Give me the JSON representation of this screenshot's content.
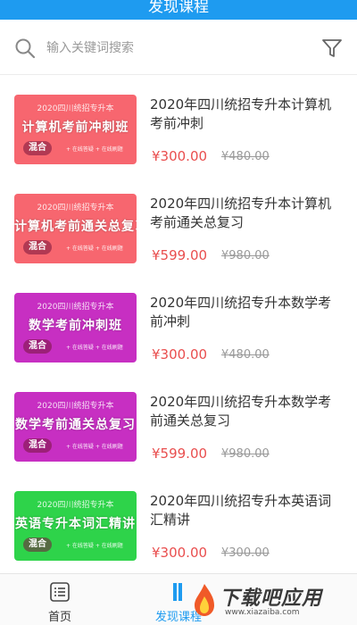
{
  "header": {
    "title": "发现课程"
  },
  "search": {
    "placeholder": "输入关键词搜索"
  },
  "colors": {
    "accent": "#1e9bf0",
    "price": "#e94e4e"
  },
  "courses": [
    {
      "title": "2020年四川统招专升本计算机考前冲刺",
      "price": "¥300.00",
      "original_price": "¥480.00",
      "thumb": {
        "year": "2020四川统招专升本",
        "title": "计算机考前冲刺班",
        "tag": "混合",
        "features": "+ 在线答疑 + 在线刷题",
        "color": "#f7666f"
      }
    },
    {
      "title": "2020年四川统招专升本计算机考前通关总复习",
      "price": "¥599.00",
      "original_price": "¥980.00",
      "thumb": {
        "year": "2020四川统招专升本",
        "title": "计算机考前通关总复习",
        "tag": "混合",
        "features": "+ 在线答疑 + 在线刷题",
        "color": "#f7666f"
      }
    },
    {
      "title": "2020年四川统招专升本数学考前冲刺",
      "price": "¥300.00",
      "original_price": "¥480.00",
      "thumb": {
        "year": "2020四川统招专升本",
        "title": "数学考前冲刺班",
        "tag": "混合",
        "features": "+ 在线答疑 + 在线刷题",
        "color": "#c72fc2"
      }
    },
    {
      "title": "2020年四川统招专升本数学考前通关总复习",
      "price": "¥599.00",
      "original_price": "¥980.00",
      "thumb": {
        "year": "2020四川统招专升本",
        "title": "数学考前通关总复习",
        "tag": "混合",
        "features": "+ 在线答疑 + 在线刷题",
        "color": "#c72fc2"
      }
    },
    {
      "title": "2020年四川统招专升本英语词汇精讲",
      "price": "¥300.00",
      "original_price": "¥300.00",
      "thumb": {
        "year": "2020四川统招专升本",
        "title": "英语专升本词汇精讲",
        "tag": "混合",
        "features": "+ 在线答疑 + 在线刷题",
        "color": "#2ed34a"
      }
    }
  ],
  "tabs": [
    {
      "label": "首页",
      "icon": "home-list-icon"
    },
    {
      "label": "发现课程",
      "icon": "discover-icon"
    }
  ],
  "watermark": {
    "text": "下载吧应用",
    "url": "www.xiazaiba.com"
  }
}
